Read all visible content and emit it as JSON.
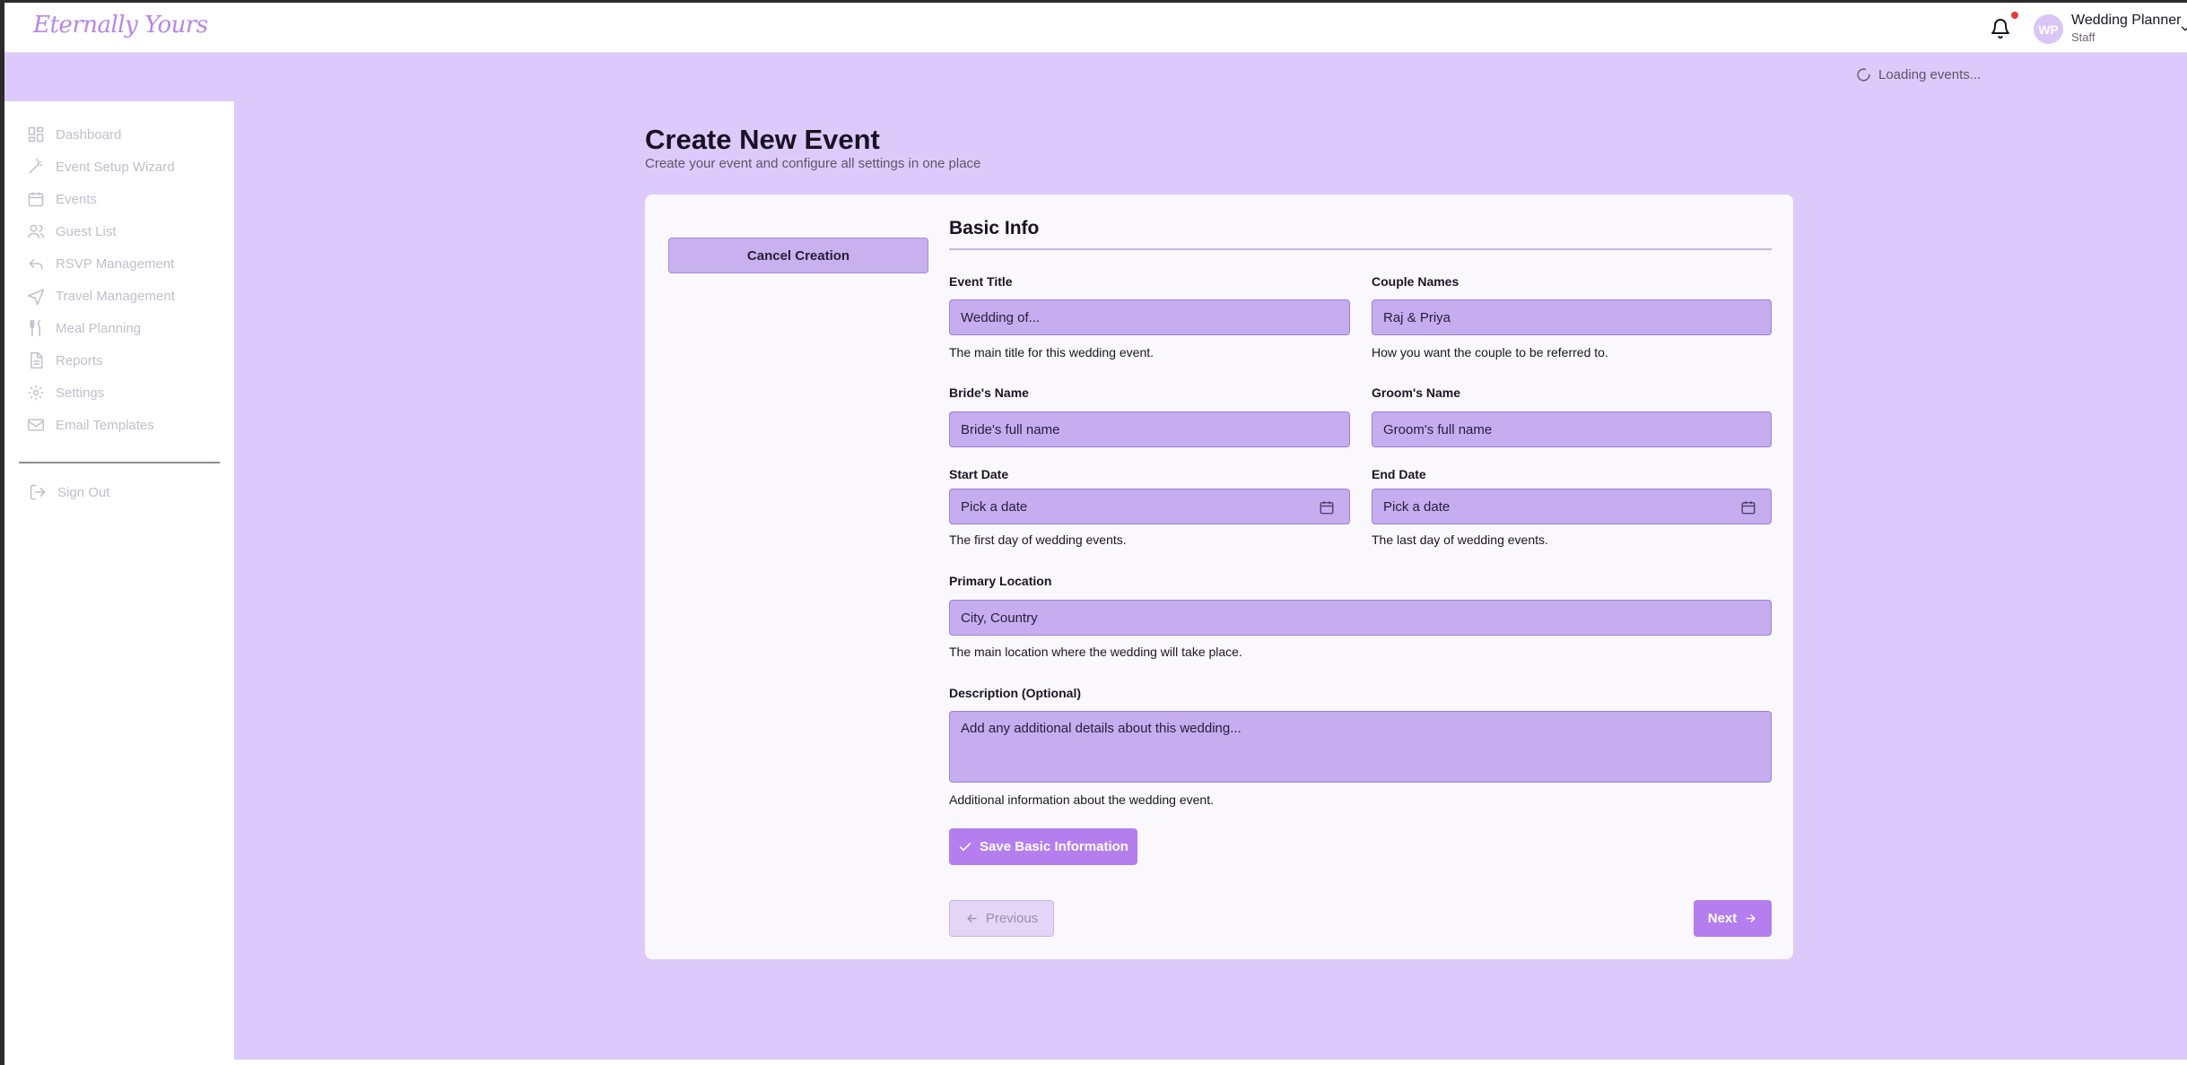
{
  "header": {
    "logo": "Eternally Yours",
    "user": {
      "initials": "WP",
      "name": "Wedding Planner",
      "role": "Staff"
    },
    "icons": [
      "bell-icon",
      "chevron-down-icon"
    ],
    "notification_dot_color": "#e33c3c"
  },
  "status": {
    "loading_text": "Loading events..."
  },
  "sidebar": {
    "items": [
      {
        "label": "Dashboard",
        "icon": "dashboard-icon"
      },
      {
        "label": "Event Setup Wizard",
        "icon": "wand-icon"
      },
      {
        "label": "Events",
        "icon": "calendar-icon"
      },
      {
        "label": "Guest List",
        "icon": "users-icon"
      },
      {
        "label": "RSVP Management",
        "icon": "reply-icon"
      },
      {
        "label": "Travel Management",
        "icon": "plane-icon"
      },
      {
        "label": "Meal Planning",
        "icon": "utensils-icon"
      },
      {
        "label": "Reports",
        "icon": "file-icon"
      },
      {
        "label": "Settings",
        "icon": "gear-icon"
      },
      {
        "label": "Email Templates",
        "icon": "mail-icon"
      }
    ],
    "sign_out": "Sign Out"
  },
  "page": {
    "title": "Create New Event",
    "subtitle": "Create your event and configure all settings in one place"
  },
  "form": {
    "cancel_label": "Cancel Creation",
    "section_title": "Basic Info",
    "event_title": {
      "label": "Event Title",
      "placeholder": "Wedding of...",
      "hint": "The main title for this wedding event."
    },
    "couple_names": {
      "label": "Couple Names",
      "placeholder": "Raj & Priya",
      "hint": "How you want the couple to be referred to."
    },
    "bride_name": {
      "label": "Bride's Name",
      "placeholder": "Bride's full name"
    },
    "groom_name": {
      "label": "Groom's Name",
      "placeholder": "Groom's full name"
    },
    "start_date": {
      "label": "Start Date",
      "placeholder": "Pick a date",
      "hint": "The first day of wedding events."
    },
    "end_date": {
      "label": "End Date",
      "placeholder": "Pick a date",
      "hint": "The last day of wedding events."
    },
    "primary_location": {
      "label": "Primary Location",
      "placeholder": "City, Country",
      "hint": "The main location where the wedding will take place."
    },
    "description": {
      "label": "Description (Optional)",
      "placeholder": "Add any additional details about this wedding...",
      "hint": "Additional information about the wedding event."
    },
    "save_label": "Save Basic Information",
    "previous_label": "Previous",
    "next_label": "Next"
  },
  "colors": {
    "accent": "#b57eef",
    "background": "#dccafa",
    "field_fill": "#c5adef",
    "logo": "#b985e6"
  }
}
